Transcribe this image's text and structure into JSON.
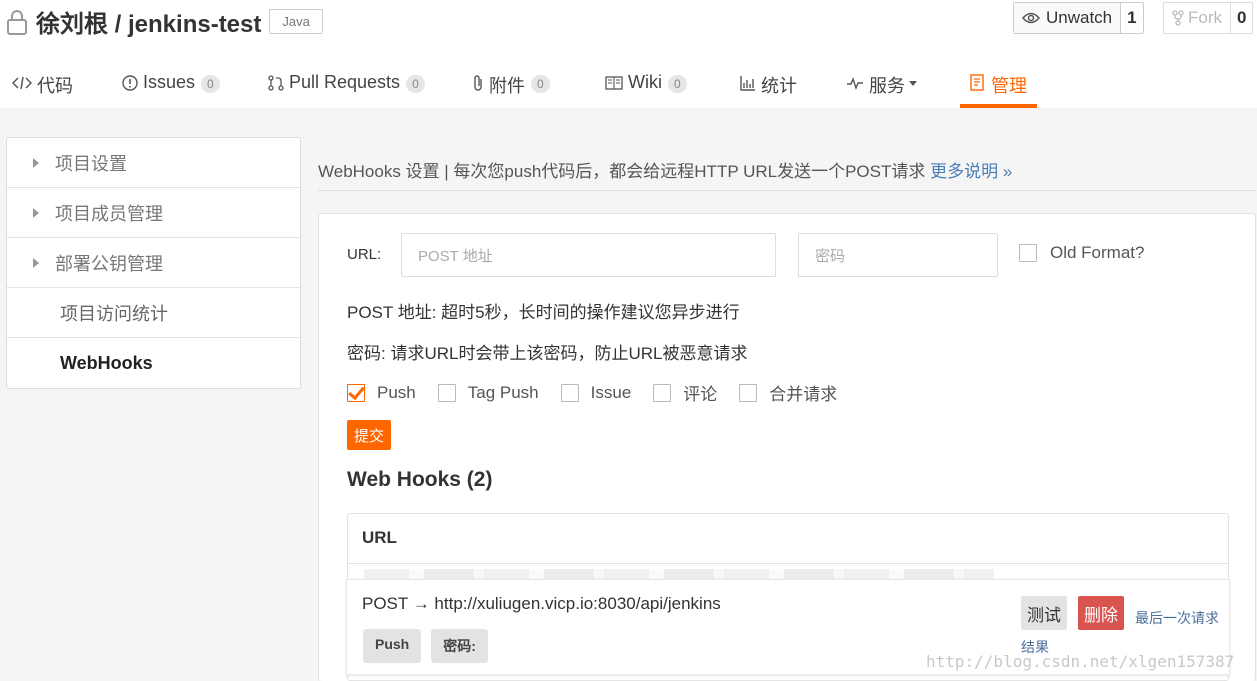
{
  "repo": {
    "title": "徐刘根 / jenkins-test",
    "language": "Java"
  },
  "actions": {
    "watch_label": "Unwatch",
    "watch_count": "1",
    "fork_label": "Fork",
    "fork_count": "0"
  },
  "tabs": [
    {
      "label": "代码",
      "icon": "code-icon",
      "count": null
    },
    {
      "label": "Issues",
      "icon": "issue-icon",
      "count": "0"
    },
    {
      "label": "Pull Requests",
      "icon": "pull-request-icon",
      "count": "0"
    },
    {
      "label": "附件",
      "icon": "attachment-icon",
      "count": "0"
    },
    {
      "label": "Wiki",
      "icon": "wiki-icon",
      "count": "0"
    },
    {
      "label": "统计",
      "icon": "stats-icon",
      "count": null
    },
    {
      "label": "服务",
      "icon": "pulse-icon",
      "count": null
    },
    {
      "label": "管理",
      "icon": "manage-icon",
      "count": null,
      "active": true
    }
  ],
  "sidebar": {
    "items": [
      {
        "label": "项目设置"
      },
      {
        "label": "项目成员管理"
      },
      {
        "label": "部署公钥管理"
      },
      {
        "label": "项目访问统计"
      },
      {
        "label": "WebHooks"
      }
    ]
  },
  "main": {
    "heading": "WebHooks 设置 | 每次您push代码后，都会给远程HTTP URL发送一个POST请求",
    "more_link": "更多说明 »",
    "url_label": "URL:",
    "url_placeholder": "POST 地址",
    "secret_placeholder": "密码",
    "old_format_label": "Old Format?",
    "hint_post": "POST 地址: 超时5秒，长时间的操作建议您异步进行",
    "hint_secret": "密码: 请求URL时会带上该密码，防止URL被恶意请求",
    "events": [
      {
        "label": "Push",
        "checked": true
      },
      {
        "label": "Tag Push",
        "checked": false
      },
      {
        "label": "Issue",
        "checked": false
      },
      {
        "label": "评论",
        "checked": false
      },
      {
        "label": "合并请求",
        "checked": false
      }
    ],
    "submit_label": "提交",
    "hooks_title": "Web Hooks (2)",
    "table_header": "URL",
    "hook": {
      "url": "POST → http://xuliugen.vicp.io:8030/api/jenkins",
      "tags": [
        "Push",
        "密码:"
      ],
      "test_label": "测试",
      "delete_label": "删除",
      "last_result_label": "最后一次请求结果"
    }
  },
  "watermark": "http://blog.csdn.net/xlgen157387",
  "colors": {
    "accent": "#ff6600",
    "danger": "#d9534f",
    "link": "#4a7db8"
  }
}
